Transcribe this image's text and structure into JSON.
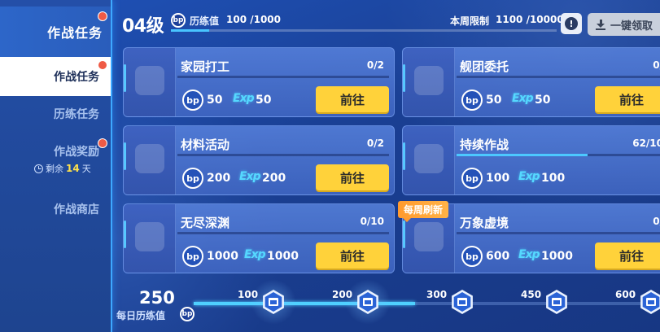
{
  "sidebar": {
    "header_label": "作战任务",
    "items": [
      {
        "label": "作战任务",
        "active": true,
        "badge": true
      },
      {
        "label": "历练任务",
        "active": false,
        "badge": false
      },
      {
        "label": "作战奖励",
        "active": false,
        "badge": true
      },
      {
        "label": "作战商店",
        "active": false,
        "badge": false
      }
    ],
    "reward_remaining_prefix": "剩余",
    "reward_remaining_days": "14",
    "reward_remaining_suffix": "天"
  },
  "top": {
    "level": "04级",
    "bp_icon": "bp",
    "xp_label": "历练值",
    "xp_value": "100 /1000",
    "xp_fraction": 0.1,
    "weekly_limit_label": "本周限制",
    "weekly_limit_value": "1100 /10000",
    "info_icon": "!",
    "claim_all_label": "一键领取"
  },
  "cards": [
    {
      "title": "家园打工",
      "progress": "0/2",
      "progress_fraction": 0.0,
      "bp": "50",
      "exp_label": "Exp",
      "exp": "50",
      "button": "前往",
      "icon": "checklist-icon"
    },
    {
      "title": "舰团委托",
      "progress": "0/",
      "progress_fraction": 0.0,
      "bp": "50",
      "exp_label": "Exp",
      "exp": "50",
      "button": "前往",
      "icon": "emblem-icon"
    },
    {
      "title": "材料活动",
      "progress": "0/2",
      "progress_fraction": 0.0,
      "bp": "200",
      "exp_label": "Exp",
      "exp": "200",
      "button": "前往",
      "icon": "silver-cube-icon"
    },
    {
      "title": "持续作战",
      "progress": "62/10",
      "progress_fraction": 0.62,
      "bp": "100",
      "exp_label": "Exp",
      "exp": "100",
      "button": "",
      "icon": "bp-coin-icon"
    },
    {
      "title": "无尽深渊",
      "progress": "0/10",
      "progress_fraction": 0.0,
      "bp": "1000",
      "exp_label": "Exp",
      "exp": "1000",
      "button": "前往",
      "icon": "blue-crystals-icon"
    },
    {
      "title": "万象虚境",
      "progress": "0/",
      "progress_fraction": 0.0,
      "bp": "600",
      "exp_label": "Exp",
      "exp": "1000",
      "button": "前往",
      "icon": "green-emblem-icon",
      "tag": "每周刷新"
    }
  ],
  "daily": {
    "value": "250",
    "label": "每日历练值",
    "bp_icon": "bp",
    "progress_value": 250,
    "milestones": [
      "100",
      "200",
      "300",
      "450",
      "600"
    ]
  },
  "colors": {
    "accent_cyan": "#4fd0ff",
    "button_yellow": "#ffd23a",
    "badge_red": "#ef5a45",
    "tag_orange": "#ff9a2e"
  }
}
